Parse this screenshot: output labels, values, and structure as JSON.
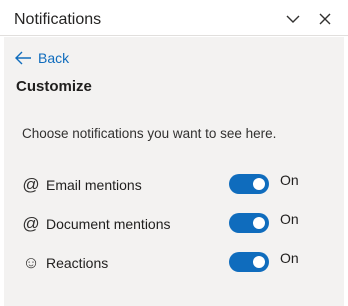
{
  "header": {
    "title": "Notifications"
  },
  "nav": {
    "back_label": "Back"
  },
  "page": {
    "title": "Customize",
    "description": "Choose notifications you want to see here."
  },
  "settings": [
    {
      "icon": "at-icon",
      "glyph": "@",
      "label": "Email mentions",
      "state": "On",
      "enabled": true
    },
    {
      "icon": "at-icon",
      "glyph": "@",
      "label": "Document mentions",
      "state": "On",
      "enabled": true
    },
    {
      "icon": "smiley-icon",
      "glyph": "☺",
      "label": "Reactions",
      "state": "On",
      "enabled": true
    }
  ],
  "colors": {
    "accent": "#0f6cbd",
    "panel_background": "#f3f2f1"
  }
}
